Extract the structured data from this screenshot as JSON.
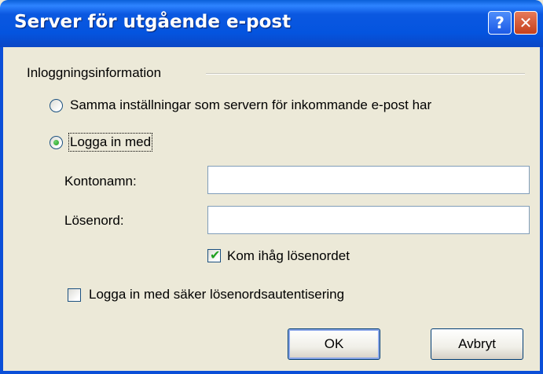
{
  "window": {
    "title": "Server för utgående e-post",
    "help_icon": "question-icon",
    "close_icon": "close-icon",
    "help_glyph": "?",
    "close_glyph": "✕"
  },
  "group": {
    "label": "Inloggningsinformation"
  },
  "options": {
    "same_settings": "Samma inställningar som servern för inkommande e-post har",
    "log_in_with": "Logga in med",
    "selected": "log_in_with"
  },
  "fields": {
    "account_label": "Kontonamn:",
    "account_value": "",
    "password_label": "Lösenord:",
    "password_value": ""
  },
  "checkboxes": {
    "remember_password": "Kom ihåg lösenordet",
    "remember_password_checked": true,
    "spa": "Logga in med säker lösenordsautentisering",
    "spa_checked": false
  },
  "buttons": {
    "ok": "OK",
    "cancel": "Avbryt"
  },
  "colors": {
    "titlebar": "#0454df",
    "dialog_bg": "#ece9d8",
    "check_green": "#21a121"
  }
}
